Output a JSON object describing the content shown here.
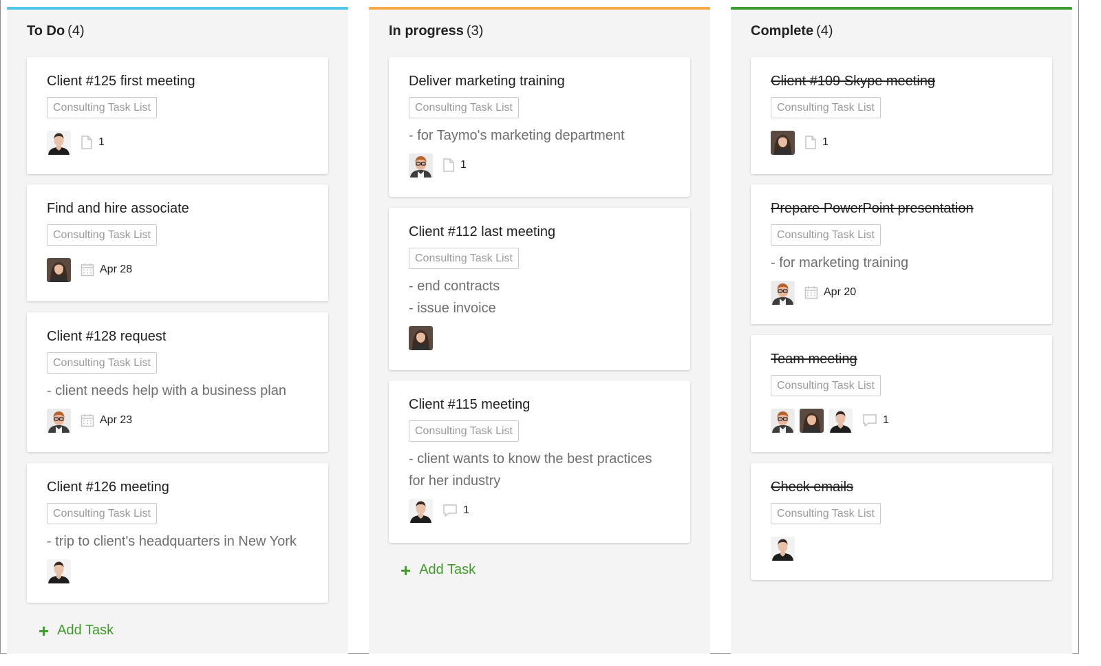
{
  "colors": {
    "todo_accent": "#4fc6ea",
    "progress_accent": "#f5a845",
    "complete_accent": "#3a9b2f",
    "add_task": "#3f9a2a"
  },
  "columns": [
    {
      "name": "To Do",
      "count": "(4)",
      "add_label": "Add Task",
      "cards": [
        {
          "title": "Client #125 first meeting",
          "tag": "Consulting Task List",
          "meta_text": "1",
          "meta_icon": "file-icon",
          "avatars": [
            "man-dark-hair"
          ]
        },
        {
          "title": "Find and hire associate",
          "tag": "Consulting Task List",
          "meta_text": "Apr 28",
          "meta_icon": "calendar-icon",
          "avatars": [
            "woman-brown-hair"
          ]
        },
        {
          "title": "Client #128 request",
          "tag": "Consulting Task List",
          "desc": [
            "- client needs help with a business plan"
          ],
          "meta_text": "Apr 23",
          "meta_icon": "calendar-icon",
          "avatars": [
            "man-glasses"
          ]
        },
        {
          "title": "Client #126 meeting",
          "tag": "Consulting Task List",
          "desc": [
            "- trip to client's headquarters in New York"
          ],
          "avatars": [
            "man-dark-hair"
          ]
        }
      ]
    },
    {
      "name": "In progress",
      "count": "(3)",
      "add_label": "Add Task",
      "cards": [
        {
          "title": "Deliver marketing training",
          "tag": "Consulting Task List",
          "desc": [
            "- for Taymo's marketing department"
          ],
          "meta_text": "1",
          "meta_icon": "file-icon",
          "avatars": [
            "man-glasses"
          ]
        },
        {
          "title": "Client #112 last meeting",
          "tag": "Consulting Task List",
          "desc": [
            "- end contracts",
            "- issue invoice"
          ],
          "avatars": [
            "woman-brown-hair"
          ]
        },
        {
          "title": "Client #115 meeting",
          "tag": "Consulting Task List",
          "desc": [
            "- client wants to know the best practices",
            "for her industry"
          ],
          "meta_text": "1",
          "meta_icon": "comment-icon",
          "avatars": [
            "man-dark-hair"
          ]
        }
      ]
    },
    {
      "name": "Complete",
      "count": "(4)",
      "cards": [
        {
          "title": "Client #109 Skype meeting",
          "tag": "Consulting Task List",
          "meta_text": "1",
          "meta_icon": "file-icon",
          "avatars": [
            "woman-brown-hair"
          ]
        },
        {
          "title": "Prepare PowerPoint presentation",
          "tag": "Consulting Task List",
          "desc": [
            "- for marketing training"
          ],
          "meta_text": "Apr 20",
          "meta_icon": "calendar-icon",
          "avatars": [
            "man-glasses"
          ]
        },
        {
          "title": "Team meeting",
          "tag": "Consulting Task List",
          "meta_text": "1",
          "meta_icon": "comment-icon",
          "avatars": [
            "man-glasses",
            "woman-brown-hair",
            "man-dark-hair"
          ]
        },
        {
          "title": "Check emails",
          "tag": "Consulting Task List",
          "avatars": [
            "man-dark-hair"
          ]
        }
      ]
    }
  ]
}
